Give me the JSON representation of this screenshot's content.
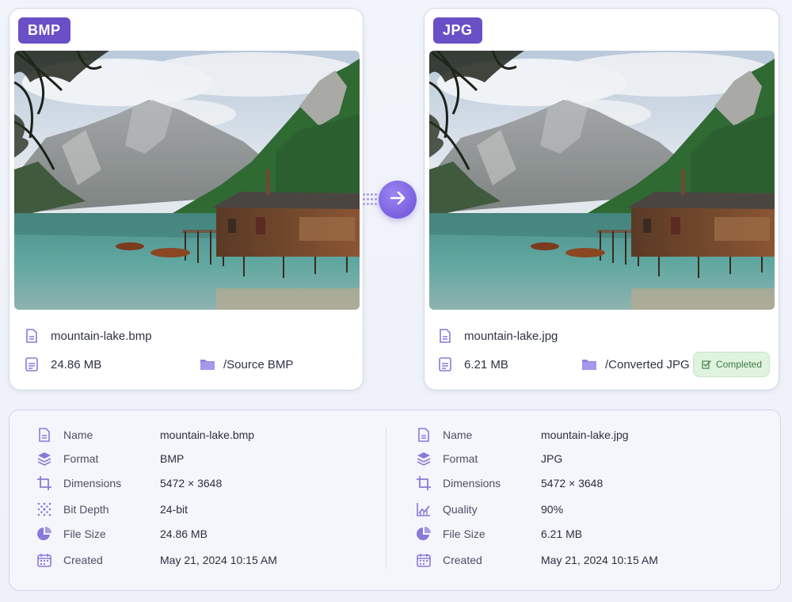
{
  "source": {
    "badge": "BMP",
    "filename": "mountain-lake.bmp",
    "size": "24.86 MB",
    "folder": "/Source BMP"
  },
  "target": {
    "badge": "JPG",
    "filename": "mountain-lake.jpg",
    "size": "6.21 MB",
    "folder": "/Converted JPG",
    "status": "Completed"
  },
  "details": {
    "left": [
      {
        "icon": "file-icon",
        "label": "Name",
        "value": "mountain-lake.bmp"
      },
      {
        "icon": "layers-icon",
        "label": "Format",
        "value": "BMP"
      },
      {
        "icon": "crop-icon",
        "label": "Dimensions",
        "value": "5472 × 3648"
      },
      {
        "icon": "dots-grid-icon",
        "label": "Bit Depth",
        "value": "24-bit"
      },
      {
        "icon": "pie-chart-icon",
        "label": "File Size",
        "value": "24.86 MB"
      },
      {
        "icon": "calendar-icon",
        "label": "Created",
        "value": "May 21, 2024  10:15 AM"
      }
    ],
    "right": [
      {
        "icon": "file-icon",
        "label": "Name",
        "value": "mountain-lake.jpg"
      },
      {
        "icon": "layers-icon",
        "label": "Format",
        "value": "JPG"
      },
      {
        "icon": "crop-icon",
        "label": "Dimensions",
        "value": "5472 × 3648"
      },
      {
        "icon": "quality-chart-icon",
        "label": "Quality",
        "value": "90%"
      },
      {
        "icon": "pie-chart-icon",
        "label": "File Size",
        "value": "6.21 MB"
      },
      {
        "icon": "calendar-icon",
        "label": "Created",
        "value": "May 21, 2024  10:15 AM"
      }
    ]
  },
  "colors": {
    "accent": "#6b4fc6",
    "icon": "#8a7ad8",
    "success_bg": "#dff3df",
    "success_text": "#3f7a44"
  }
}
